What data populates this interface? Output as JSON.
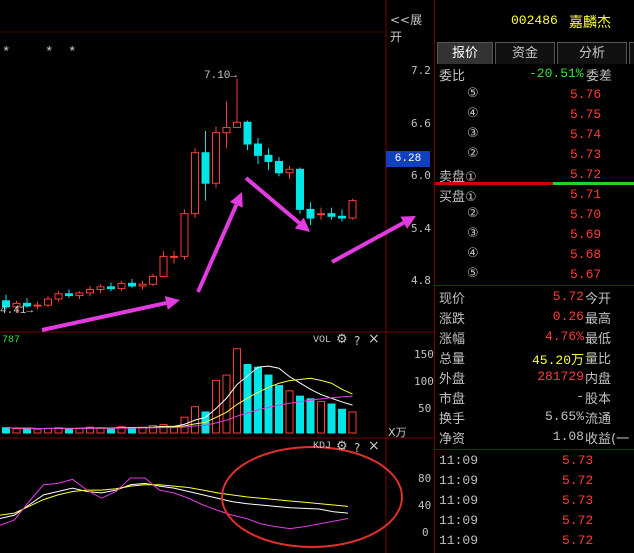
{
  "header": {
    "code": "002486",
    "name": "嘉麟杰",
    "expand_label": "<<展开"
  },
  "tabs": [
    "报价",
    "资金",
    "分析"
  ],
  "order_book": {
    "weibi_label": "委比",
    "weibi_value": "-20.51%",
    "weicha_label": "委差",
    "sell": [
      {
        "num": "⑤",
        "price": "5.76"
      },
      {
        "num": "④",
        "price": "5.75"
      },
      {
        "num": "③",
        "price": "5.74"
      },
      {
        "num": "②",
        "price": "5.73"
      },
      {
        "num": "卖盘①",
        "price": "5.72"
      }
    ],
    "buy": [
      {
        "num": "买盘①",
        "price": "5.71"
      },
      {
        "num": "②",
        "price": "5.70"
      },
      {
        "num": "③",
        "price": "5.69"
      },
      {
        "num": "④",
        "price": "5.68"
      },
      {
        "num": "⑤",
        "price": "5.67"
      }
    ]
  },
  "stats": [
    {
      "label": "现价",
      "value": "5.72",
      "label2": "今开",
      "color": "red"
    },
    {
      "label": "涨跌",
      "value": "0.26",
      "label2": "最高",
      "color": "red"
    },
    {
      "label": "涨幅",
      "value": "4.76%",
      "label2": "最低",
      "color": "red"
    },
    {
      "label": "总量",
      "value": "45.20万",
      "label2": "量比",
      "color": "yellow"
    },
    {
      "label": "外盘",
      "value": "281729",
      "label2": "内盘",
      "color": "red"
    },
    {
      "label": "市盘",
      "value": "-",
      "label2": "股本",
      "color": "gray"
    },
    {
      "label": "换手",
      "value": "5.65%",
      "label2": "流通",
      "color": "gray"
    },
    {
      "label": "净资",
      "value": "1.08",
      "label2": "收益(一",
      "color": "gray"
    }
  ],
  "ticks": [
    {
      "time": "11:09",
      "price": "5.73"
    },
    {
      "time": "11:09",
      "price": "5.72"
    },
    {
      "time": "11:09",
      "price": "5.73"
    },
    {
      "time": "11:09",
      "price": "5.72"
    },
    {
      "time": "11:09",
      "price": "5.72"
    }
  ],
  "chart": {
    "price_axis": [
      "7.2",
      "6.6",
      "6.0",
      "5.4",
      "4.8"
    ],
    "current_price_tag": "6.28",
    "high_label": "7.10",
    "low_label": "4.41",
    "stars": [
      "*",
      "*",
      "*"
    ],
    "vol_label": "VOL",
    "vol_prefix": "787",
    "vol_axis": [
      "150",
      "100",
      "50"
    ],
    "vol_unit": "X万",
    "kdj_label": "KDJ",
    "kdj_axis": [
      "80",
      "40",
      "0"
    ],
    "help_icon": "?",
    "close_icon": "×"
  },
  "colors": {
    "up": "#ff3b3b",
    "down": "#00e5e5",
    "arrow": "#e23be2",
    "circle": "#e0302a",
    "price_tag_bg": "#1040c0"
  },
  "chart_data": {
    "type": "candlestick",
    "ylim": [
      4.41,
      7.3
    ],
    "candles": [
      {
        "o": 4.55,
        "h": 4.62,
        "l": 4.45,
        "c": 4.48
      },
      {
        "o": 4.48,
        "h": 4.55,
        "l": 4.41,
        "c": 4.52
      },
      {
        "o": 4.52,
        "h": 4.58,
        "l": 4.47,
        "c": 4.49
      },
      {
        "o": 4.49,
        "h": 4.54,
        "l": 4.45,
        "c": 4.5
      },
      {
        "o": 4.5,
        "h": 4.6,
        "l": 4.48,
        "c": 4.57
      },
      {
        "o": 4.57,
        "h": 4.66,
        "l": 4.54,
        "c": 4.63
      },
      {
        "o": 4.63,
        "h": 4.68,
        "l": 4.58,
        "c": 4.61
      },
      {
        "o": 4.61,
        "h": 4.66,
        "l": 4.57,
        "c": 4.64
      },
      {
        "o": 4.64,
        "h": 4.72,
        "l": 4.6,
        "c": 4.68
      },
      {
        "o": 4.68,
        "h": 4.74,
        "l": 4.64,
        "c": 4.71
      },
      {
        "o": 4.71,
        "h": 4.76,
        "l": 4.66,
        "c": 4.69
      },
      {
        "o": 4.69,
        "h": 4.78,
        "l": 4.66,
        "c": 4.75
      },
      {
        "o": 4.75,
        "h": 4.8,
        "l": 4.7,
        "c": 4.72
      },
      {
        "o": 4.72,
        "h": 4.78,
        "l": 4.68,
        "c": 4.74
      },
      {
        "o": 4.74,
        "h": 4.86,
        "l": 4.72,
        "c": 4.83
      },
      {
        "o": 4.83,
        "h": 5.12,
        "l": 4.82,
        "c": 5.06
      },
      {
        "o": 5.06,
        "h": 5.12,
        "l": 4.98,
        "c": 5.06
      },
      {
        "o": 5.06,
        "h": 5.6,
        "l": 5.02,
        "c": 5.55
      },
      {
        "o": 5.55,
        "h": 6.3,
        "l": 5.5,
        "c": 6.25
      },
      {
        "o": 6.25,
        "h": 6.5,
        "l": 5.7,
        "c": 5.9
      },
      {
        "o": 5.9,
        "h": 6.55,
        "l": 5.85,
        "c": 6.48
      },
      {
        "o": 6.48,
        "h": 6.84,
        "l": 6.3,
        "c": 6.54
      },
      {
        "o": 6.54,
        "h": 7.1,
        "l": 6.55,
        "c": 6.6
      },
      {
        "o": 6.6,
        "h": 6.62,
        "l": 6.28,
        "c": 6.35
      },
      {
        "o": 6.35,
        "h": 6.42,
        "l": 6.12,
        "c": 6.22
      },
      {
        "o": 6.22,
        "h": 6.3,
        "l": 6.05,
        "c": 6.15
      },
      {
        "o": 6.15,
        "h": 6.2,
        "l": 5.98,
        "c": 6.02
      },
      {
        "o": 6.02,
        "h": 6.1,
        "l": 5.95,
        "c": 6.06
      },
      {
        "o": 6.06,
        "h": 6.08,
        "l": 5.55,
        "c": 5.6
      },
      {
        "o": 5.6,
        "h": 5.68,
        "l": 5.42,
        "c": 5.5
      },
      {
        "o": 5.55,
        "h": 5.62,
        "l": 5.48,
        "c": 5.55
      },
      {
        "o": 5.55,
        "h": 5.62,
        "l": 5.48,
        "c": 5.52
      },
      {
        "o": 5.52,
        "h": 5.6,
        "l": 5.46,
        "c": 5.5
      },
      {
        "o": 5.5,
        "h": 5.72,
        "l": 5.48,
        "c": 5.7
      }
    ],
    "volumes": [
      10,
      8,
      9,
      7,
      9,
      10,
      8,
      9,
      11,
      10,
      9,
      12,
      10,
      11,
      14,
      16,
      12,
      30,
      50,
      40,
      100,
      110,
      160,
      130,
      125,
      110,
      90,
      80,
      70,
      65,
      60,
      55,
      45,
      40
    ],
    "kdj_k": [
      20,
      25,
      40,
      55,
      60,
      65,
      60,
      58,
      62,
      70,
      72,
      68,
      65,
      60,
      55,
      50,
      45,
      42,
      40,
      38,
      36,
      35,
      34,
      30,
      28
    ],
    "kdj_d": [
      25,
      28,
      38,
      48,
      55,
      60,
      62,
      62,
      64,
      68,
      70,
      70,
      68,
      66,
      62,
      58,
      55,
      52,
      50,
      48,
      46,
      44,
      42,
      40,
      38
    ],
    "kdj_j": [
      10,
      18,
      45,
      70,
      72,
      78,
      62,
      50,
      60,
      80,
      80,
      62,
      58,
      50,
      40,
      32,
      25,
      20,
      12,
      8,
      5,
      8,
      12,
      16,
      20
    ]
  }
}
